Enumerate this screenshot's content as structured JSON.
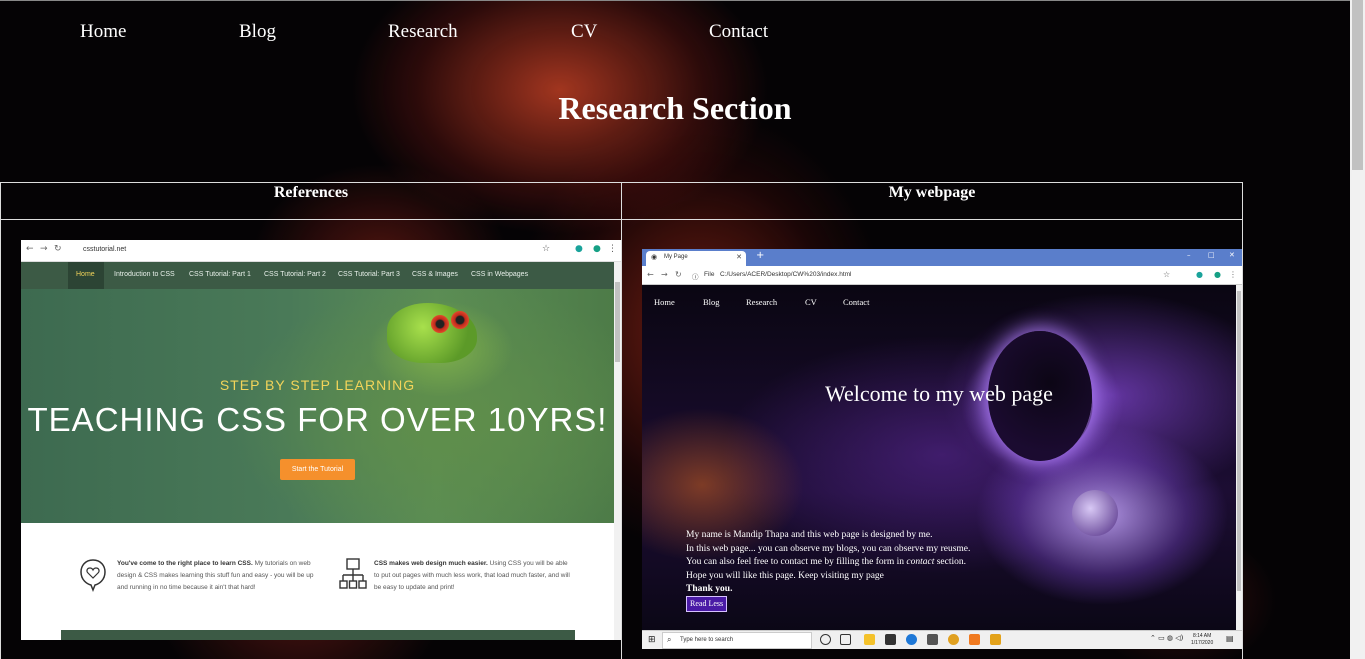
{
  "nav": {
    "items": [
      "Home",
      "Blog",
      "Research",
      "CV",
      "Contact"
    ]
  },
  "page_title": "Research Section",
  "table": {
    "headers": [
      "References",
      "My webpage"
    ]
  },
  "reference_shot": {
    "url": "csstutorial.net",
    "nav_items": [
      "Home",
      "Introduction to CSS",
      "CSS Tutorial: Part 1",
      "CSS Tutorial: Part 2",
      "CSS Tutorial: Part 3",
      "CSS & Images",
      "CSS in Webpages"
    ],
    "hero_sub": "STEP BY STEP LEARNING",
    "hero_title": "TEACHING CSS FOR OVER 10YRS!",
    "hero_button": "Start the Tutorial",
    "feature1_bold": "You've come to the right place to learn CSS.",
    "feature1_text": " My tutorials on web design & CSS makes learning this stuff fun and easy - you will be up and running in no time because it ain't that hard!",
    "feature2_bold": "CSS makes web design much easier.",
    "feature2_text": " Using CSS you will be able to put out pages with much less work, that load much faster, and will be easy to update and print!"
  },
  "webpage_shot": {
    "tab_title": "My Page",
    "url": "C:/Users/ACER/Desktop/CW%203/index.html",
    "url_prefix": "File",
    "nav_items": [
      "Home",
      "Blog",
      "Research",
      "CV",
      "Contact"
    ],
    "welcome": "Welcome to my web page",
    "bio": [
      "My name is Mandip Thapa and this web page is designed by me.",
      "In this web page... you can observe my blogs, you can observe my reusme.",
      "You can also feel free to contact me by filling the form in ",
      "Hope you will like this page. Keep visiting my page",
      "Thank you."
    ],
    "bio_contact_word": "contact",
    "bio_line3_end": " section.",
    "read_less": "Read Less",
    "taskbar_search": "Type here to search",
    "clock_time": "8:14 AM",
    "clock_date": "1/17/2020"
  }
}
